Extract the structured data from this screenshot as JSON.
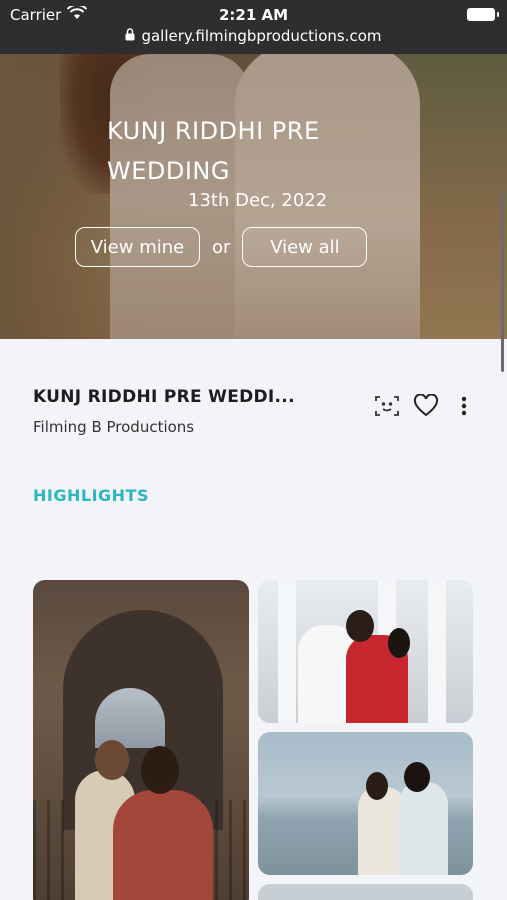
{
  "status_bar": {
    "carrier": "Carrier",
    "time": "2:21 AM",
    "url": "gallery.filmingbproductions.com"
  },
  "hero": {
    "title": "KUNJ RIDDHI PRE WEDDING",
    "date": "13th Dec, 2022",
    "view_mine_label": "View mine",
    "or_label": "or",
    "view_all_label": "View all"
  },
  "gallery_info": {
    "title": "KUNJ RIDDHI PRE WEDDI...",
    "studio": "Filming B Productions",
    "icons": [
      "face-scan-icon",
      "heart-icon",
      "more-vertical-icon"
    ]
  },
  "section": {
    "label": "HIGHLIGHTS"
  },
  "colors": {
    "accent": "#2bb5c0",
    "status_bar_bg": "#2e2e30",
    "page_bg": "#f3f4f8"
  }
}
